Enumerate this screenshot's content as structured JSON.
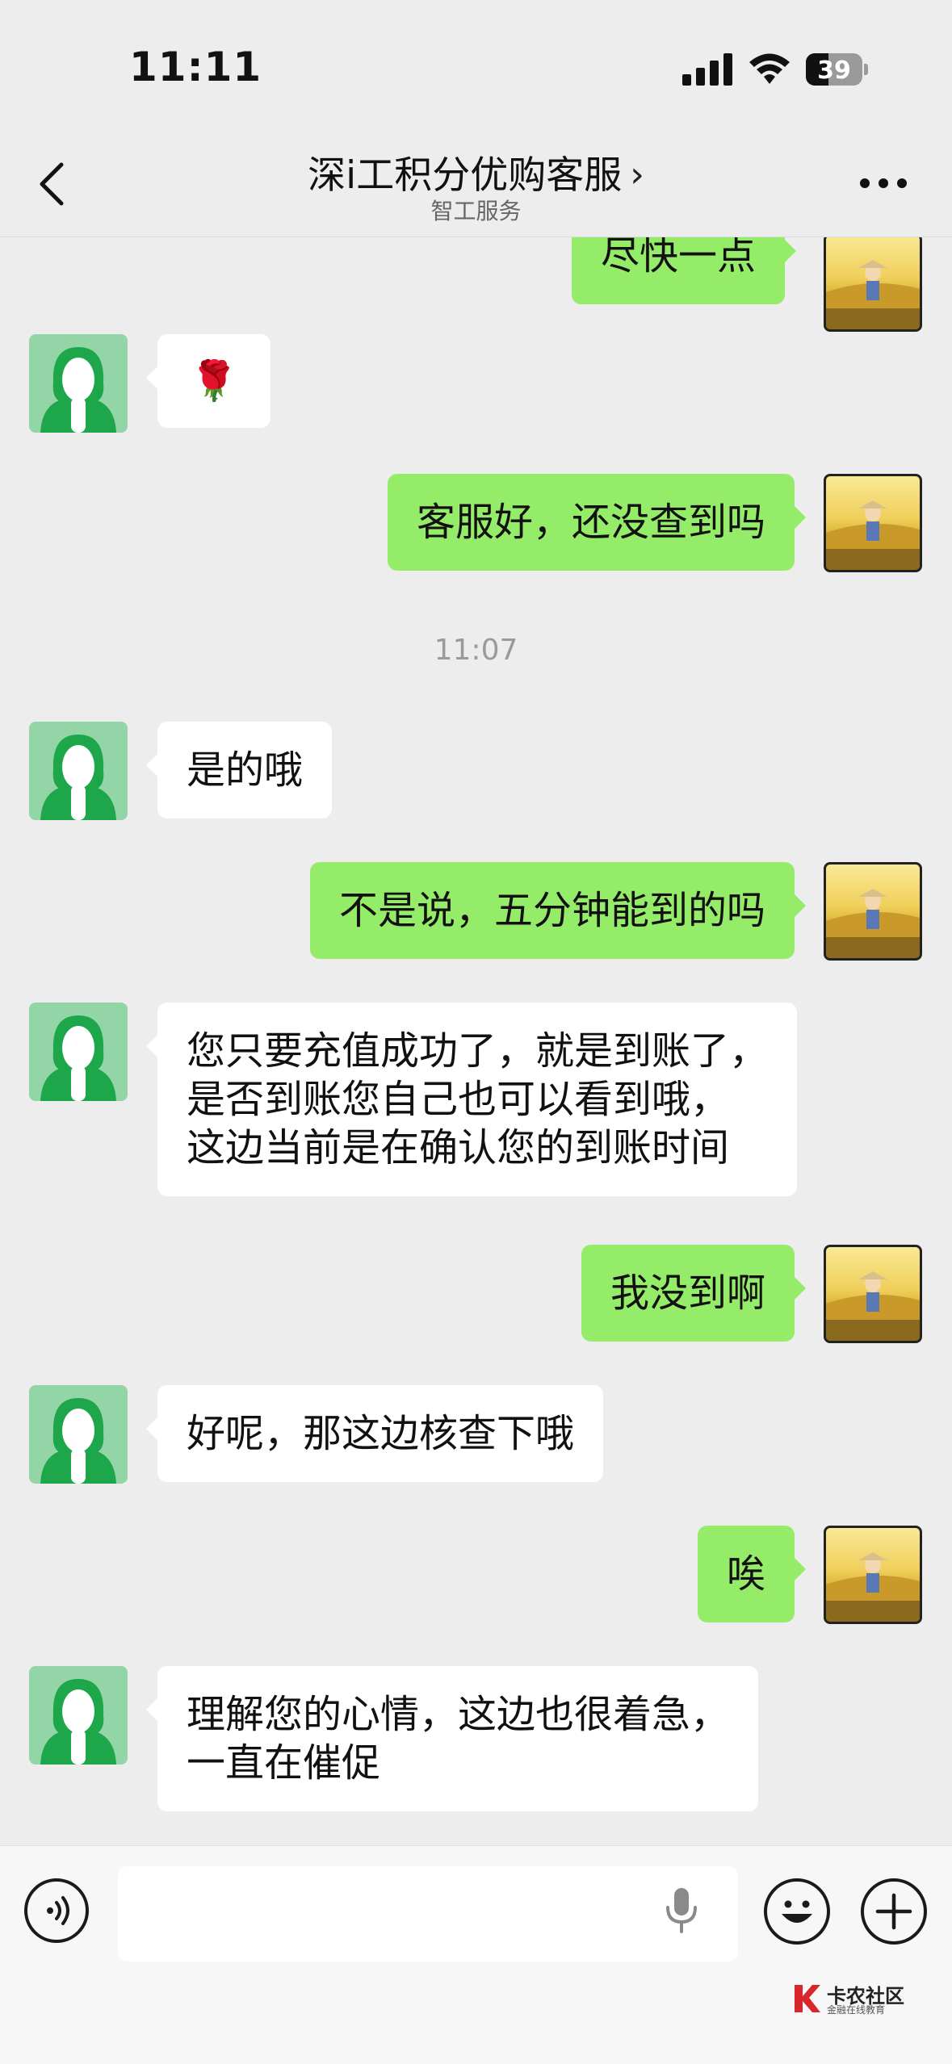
{
  "status_bar": {
    "time": "11:11",
    "battery": "39"
  },
  "header": {
    "title": "深i工积分优购客服",
    "subtitle": "智工服务"
  },
  "messages": [
    {
      "side": "right",
      "text": "尽快一点"
    },
    {
      "side": "left",
      "text": "🌹"
    },
    {
      "side": "right",
      "text": "客服好，还没查到吗"
    },
    {
      "timestamp": "11:07"
    },
    {
      "side": "left",
      "text": "是的哦"
    },
    {
      "side": "right",
      "text": "不是说，五分钟能到的吗"
    },
    {
      "side": "left",
      "lines": [
        "您只要充值成功了，就是到账了，",
        "是否到账您自己也可以看到哦，",
        "这边当前是在确认您的到账时间"
      ]
    },
    {
      "side": "right",
      "text": "我没到啊"
    },
    {
      "side": "left",
      "text": "好呢，那这边核查下哦"
    },
    {
      "side": "right",
      "text": "唉"
    },
    {
      "side": "left",
      "lines": [
        "理解您的心情，这边也很着急，",
        "一直在催促"
      ]
    }
  ],
  "watermark": {
    "title": "卡农社区",
    "subtitle": "金融在线教育"
  },
  "colors": {
    "background": "#ededed",
    "sent_bubble": "#95ec69",
    "received_bubble": "#ffffff",
    "agent_avatar": "#94d5a8",
    "agent_avatar_figure": "#1ea64a"
  },
  "icons": [
    "chevron-left-icon",
    "more-icon",
    "voice-icon",
    "mic-icon",
    "emoji-icon",
    "plus-icon",
    "signal-icon",
    "wifi-icon",
    "battery-icon"
  ]
}
